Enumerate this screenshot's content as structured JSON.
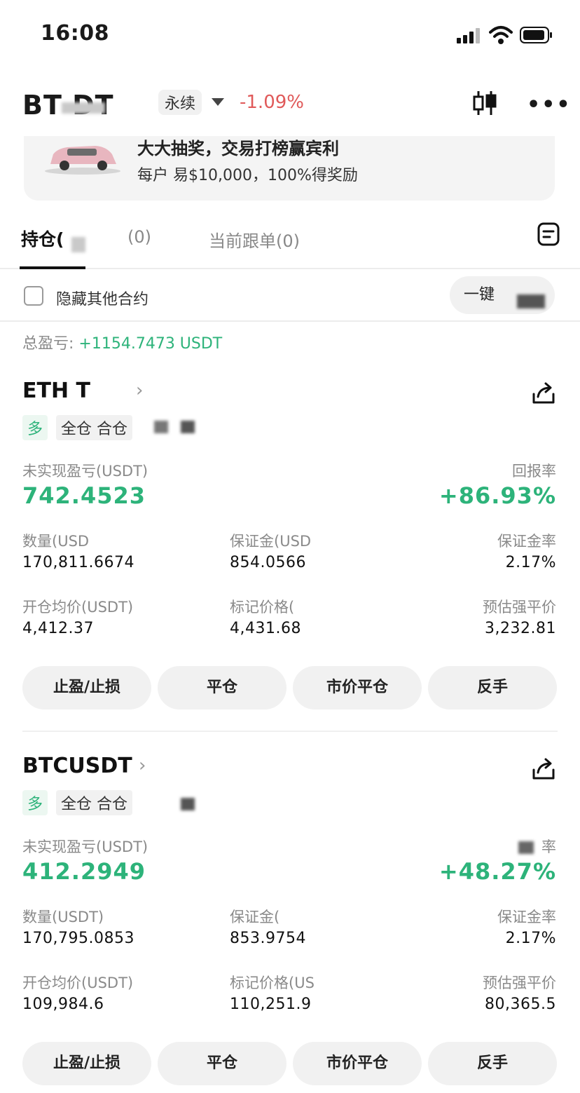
{
  "status_bar": {
    "time": "16:08"
  },
  "header": {
    "symbol": "BT  DT",
    "contract_type": "永续",
    "change": "-1.09%"
  },
  "banner": {
    "title": "大大抽奖，交易打榜赢宾利",
    "subtitle": "每户 易$10,000，100%得奖励"
  },
  "tabs": [
    "持仓(",
    "(0)",
    "当前跟单(0)"
  ],
  "filter": {
    "hide_label": "隐藏其他合约",
    "one_click": "一键"
  },
  "total": {
    "label": "总盈亏: ",
    "value": "+1154.7473 USDT"
  },
  "positions": [
    {
      "name": "ETH   T",
      "side": "多",
      "mode": "全仓 合仓",
      "upnl_label": "未实现盈亏(USDT)",
      "upnl": "742.4523",
      "roe_label": "回报率",
      "roe": "+86.93%",
      "qty_label": "数量(USD",
      "qty": "170,811.6674",
      "margin_label": "保证金(USD",
      "margin": "854.0566",
      "margin_rate_label": "保证金率",
      "margin_rate": "2.17%",
      "entry_label": "开仓均价(USDT)",
      "entry": "4,412.37",
      "mark_label": "标记价格(",
      "mark": "4,431.68",
      "liq_label": "预估强平价",
      "liq": "3,232.81"
    },
    {
      "name": "BTCUSDT",
      "side": "多",
      "mode": "全仓 合仓",
      "upnl_label": "未实现盈亏(USDT)",
      "upnl": "412.2949",
      "roe_label": "率",
      "roe": "+48.27%",
      "qty_label": "数量(USDT)",
      "qty": "170,795.0853",
      "margin_label": "保证金(",
      "margin": "853.9754",
      "margin_rate_label": "保证金率",
      "margin_rate": "2.17%",
      "entry_label": "开仓均价(USDT)",
      "entry": "109,984.6",
      "mark_label": "标记价格(US",
      "mark": "110,251.9",
      "liq_label": "预估强平价",
      "liq": "80,365.5"
    }
  ],
  "actions": {
    "tpsl": "止盈/止损",
    "close": "平仓",
    "market_close": "市价平仓",
    "reverse": "反手"
  },
  "icons": [
    "signal-icon",
    "wifi-icon",
    "battery-icon",
    "candlestick-icon",
    "more-icon",
    "document-icon",
    "share-icon",
    "chevron-right-icon"
  ],
  "colors": {
    "profit": "#2db37a",
    "loss": "#e05a5a"
  }
}
